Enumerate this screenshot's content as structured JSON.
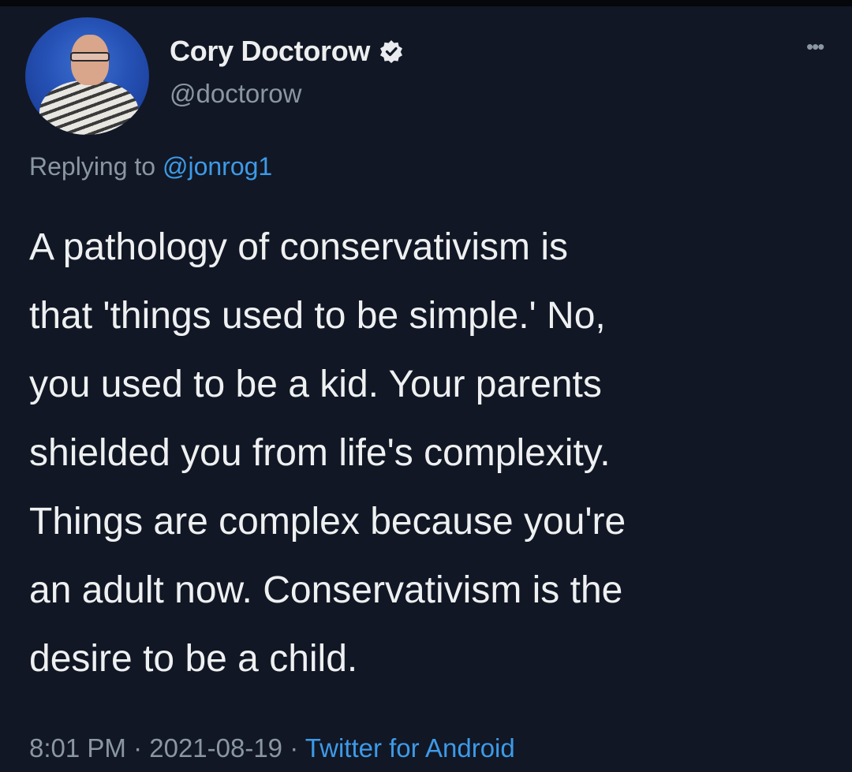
{
  "tweet": {
    "author": {
      "name": "Cory Doctorow",
      "handle": "@doctorow",
      "verified_icon": "verified-badge-icon"
    },
    "reply_prefix": "Replying to ",
    "reply_to": "@jonrog1",
    "text": "A pathology of conservativism is\nthat 'things used to be simple.' No,\nyou used to be a kid. Your parents\nshielded you from life's complexity.\nThings are complex because you're\nan adult now. Conservativism is the\ndesire to be a child.",
    "time": "8:01 PM",
    "date": "2021-08-19",
    "separator": " · ",
    "source": "Twitter for Android",
    "more_icon": "more-options-icon"
  },
  "colors": {
    "background": "#111724",
    "text": "#eef0f1",
    "muted": "#8b96a3",
    "link": "#3d9ae8"
  }
}
